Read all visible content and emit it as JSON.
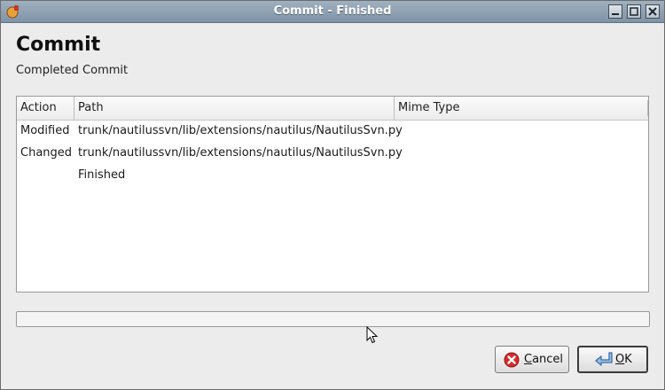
{
  "window": {
    "title": "Commit - Finished"
  },
  "header": {
    "title": "Commit",
    "subtitle": "Completed Commit"
  },
  "table": {
    "columns": [
      "Action",
      "Path",
      "Mime Type"
    ],
    "rows": [
      {
        "action": "Modified",
        "path": "trunk/nautilussvn/lib/extensions/nautilus/NautilusSvn.py",
        "mime": ""
      },
      {
        "action": "Changed",
        "path": "trunk/nautilussvn/lib/extensions/nautilus/NautilusSvn.py",
        "mime": ""
      },
      {
        "action": "",
        "path": "Finished",
        "mime": ""
      }
    ]
  },
  "progress": {
    "value": 0
  },
  "buttons": {
    "cancel": {
      "mnemonic": "C",
      "rest": "ancel"
    },
    "ok": {
      "mnemonic": "O",
      "rest": "K"
    }
  },
  "colors": {
    "titlebar": "#8fa2b5",
    "cancel_icon": "#d62a2a",
    "ok_icon": "#3a6ea5"
  }
}
